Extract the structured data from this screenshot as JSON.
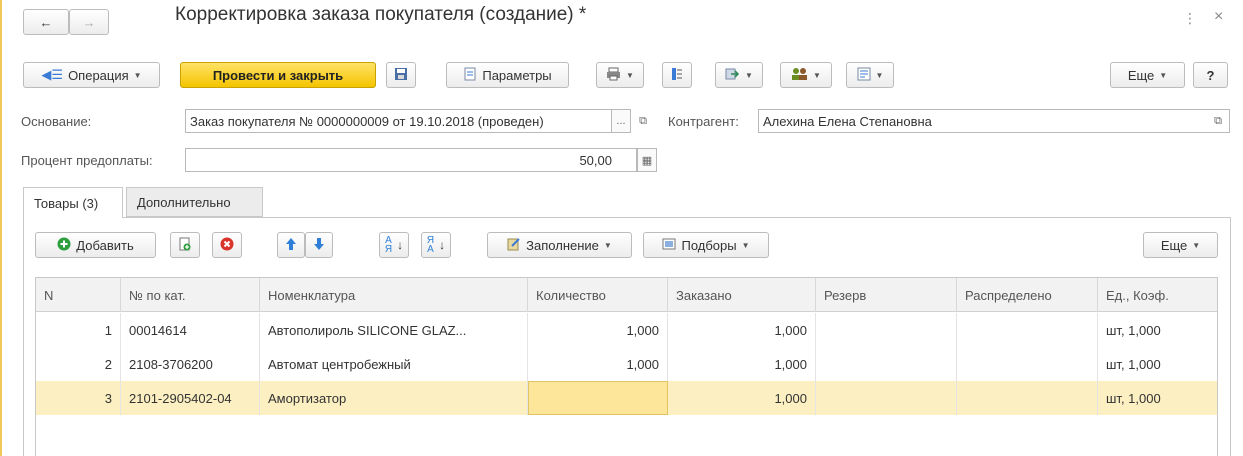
{
  "window": {
    "title": "Корректировка заказа покупателя (создание) *",
    "menu_icon": "⋮",
    "close_icon": "×"
  },
  "toolbar": {
    "operation_label": "Операция",
    "post_close_label": "Провести и закрыть",
    "params_label": "Параметры",
    "more_label": "Еще",
    "help_label": "?"
  },
  "form": {
    "basis_label": "Основание:",
    "basis_value": "Заказ покупателя № 0000000009  от 19.10.2018 (проведен)",
    "basis_ellipsis": "...",
    "counterparty_label": "Контрагент:",
    "counterparty_value": "Алехина Елена Степановна",
    "prepay_label": "Процент предоплаты:",
    "prepay_value": "50,00"
  },
  "tabs": [
    {
      "label": "Товары (3)",
      "active": true
    },
    {
      "label": "Дополнительно",
      "active": false
    }
  ],
  "table_toolbar": {
    "add_label": "Добавить",
    "fill_label": "Заполнение",
    "pick_label": "Подборы",
    "more_label": "Еще"
  },
  "table": {
    "headers": [
      "N",
      "№ по кат.",
      "Номенклатура",
      "Количество",
      "Заказано",
      "Резерв",
      "Распределено",
      "Ед., Коэф."
    ],
    "rows": [
      [
        "1",
        "00014614",
        "Автополироль SILICONE GLAZ...",
        "1,000",
        "1,000",
        "",
        "",
        "шт, 1,000"
      ],
      [
        "2",
        "2108-3706200",
        "Автомат центробежный",
        "1,000",
        "1,000",
        "",
        "",
        "шт, 1,000"
      ],
      [
        "3",
        "2101-2905402-04",
        "Амортизатор",
        "",
        "1,000",
        "",
        "",
        "шт, 1,000"
      ]
    ],
    "selected_row": 2
  },
  "colors": {
    "primary_button": "#f4c400",
    "selected_row": "#fcefc2",
    "active_cell": "#fde69a"
  }
}
